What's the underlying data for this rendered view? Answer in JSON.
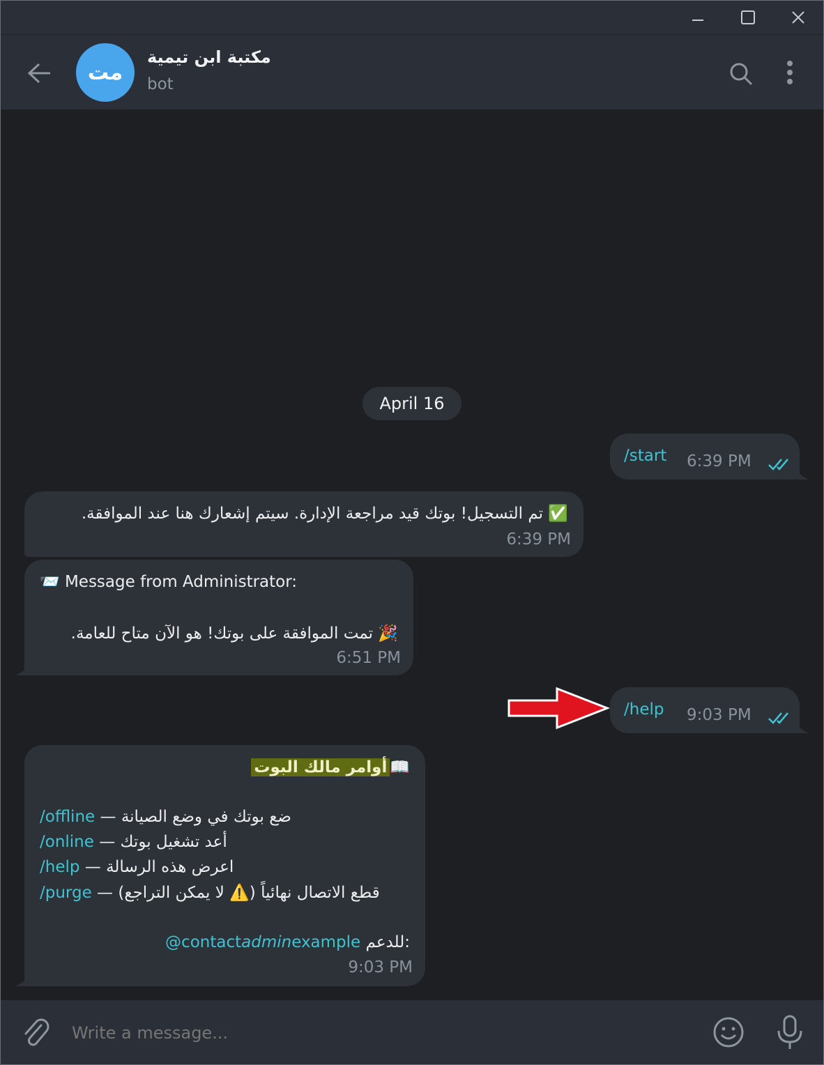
{
  "window": {
    "minimize_icon": "minimize-icon",
    "maximize_icon": "maximize-icon",
    "close_icon": "close-icon"
  },
  "header": {
    "avatar_initials": "مت",
    "title": "مكتبة ابن تيمية",
    "subtitle": "bot",
    "back_icon": "back-arrow-icon",
    "search_icon": "search-icon",
    "menu_icon": "more-vertical-icon"
  },
  "chat": {
    "date": "April 16",
    "messages": [
      {
        "dir": "out",
        "text": "/start",
        "time": "6:39 PM",
        "status": "double-check-icon"
      },
      {
        "dir": "in",
        "emoji": "✅",
        "text": "تم التسجيل! بوتك قيد مراجعة الإدارة. سيتم إشعارك هنا عند الموافقة.",
        "time": "6:39 PM"
      },
      {
        "dir": "in",
        "emoji": "📨",
        "line1": "Message from Administrator:",
        "emoji2": "🎉",
        "line2": "تمت الموافقة على بوتك! هو الآن متاح للعامة.",
        "time": "6:51 PM"
      },
      {
        "dir": "out",
        "text": "/help",
        "time": "9:03 PM",
        "status": "double-check-icon"
      },
      {
        "dir": "in",
        "heading_emoji": "📖",
        "heading": "أوامر مالك البوت",
        "commands": [
          {
            "desc": "ضع بوتك في وضع الصيانة",
            "dash": "—",
            "cmd": "/offline"
          },
          {
            "desc": "أعد تشغيل بوتك",
            "dash": "—",
            "cmd": "/online"
          },
          {
            "desc": "اعرض هذه الرسالة",
            "dash": "—",
            "cmd": "/help"
          },
          {
            "desc": "قطع الاتصال نهائياً (⚠️ لا يمكن التراجع)",
            "dash": "—",
            "cmd": "/purge"
          }
        ],
        "support_label": "للدعم:",
        "support_contact_a": "@contact",
        "support_contact_b": "admin",
        "support_contact_c": "example",
        "time": "9:03 PM"
      }
    ]
  },
  "annotation": {
    "arrow_color": "#e0141e",
    "arrow_outline": "#ffffff"
  },
  "composer": {
    "placeholder": "Write a message...",
    "attach_icon": "paperclip-icon",
    "emoji_icon": "emoji-icon",
    "mic_icon": "microphone-icon"
  },
  "colors": {
    "accent": "#3fc3d2",
    "avatar": "#4aa6ec",
    "bubble": "#2d3238"
  }
}
